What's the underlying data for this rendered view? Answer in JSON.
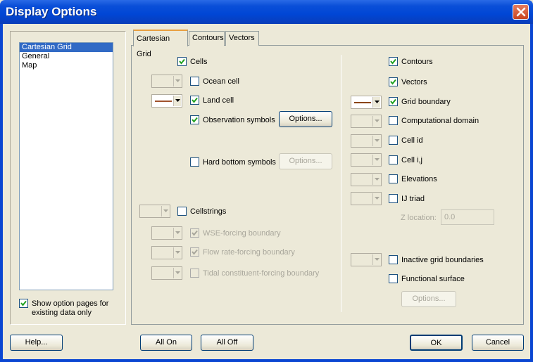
{
  "window": {
    "title": "Display Options"
  },
  "list": {
    "items": [
      "Cartesian Grid",
      "General",
      "Map"
    ],
    "selected_index": 0
  },
  "show_option_pages": {
    "line1": "Show option pages for",
    "line2": "existing data only",
    "checked": true
  },
  "tabs": [
    "Cartesian Grid",
    "Contours",
    "Vectors"
  ],
  "left": {
    "cells": "Cells",
    "ocean_cell": "Ocean cell",
    "land_cell": "Land cell",
    "observation_symbols": "Observation symbols",
    "options1": "Options...",
    "hard_bottom_symbols": "Hard bottom symbols",
    "options2": "Options...",
    "cellstrings": "Cellstrings",
    "wse_forcing": "WSE-forcing boundary",
    "flow_rate_forcing": "Flow rate-forcing boundary",
    "tidal_forcing": "Tidal constituent-forcing boundary"
  },
  "right": {
    "contours": "Contours",
    "vectors": "Vectors",
    "grid_boundary": "Grid boundary",
    "computational_domain": "Computational domain",
    "cell_id": "Cell id",
    "cell_ij": "Cell i,j",
    "elevations": "Elevations",
    "ij_triad": "IJ triad",
    "z_location_label": "Z location:",
    "z_location_value": "0.0",
    "inactive_grid_boundaries": "Inactive grid boundaries",
    "functional_surface": "Functional surface",
    "options3": "Options..."
  },
  "buttons": {
    "help": "Help...",
    "all_on": "All On",
    "all_off": "All Off",
    "ok": "OK",
    "cancel": "Cancel"
  },
  "colors": {
    "land_cell_line": "#a0522d",
    "grid_boundary_line": "#8b4513",
    "selection": "#316ac5",
    "titlebar": "#0a4fd8"
  }
}
